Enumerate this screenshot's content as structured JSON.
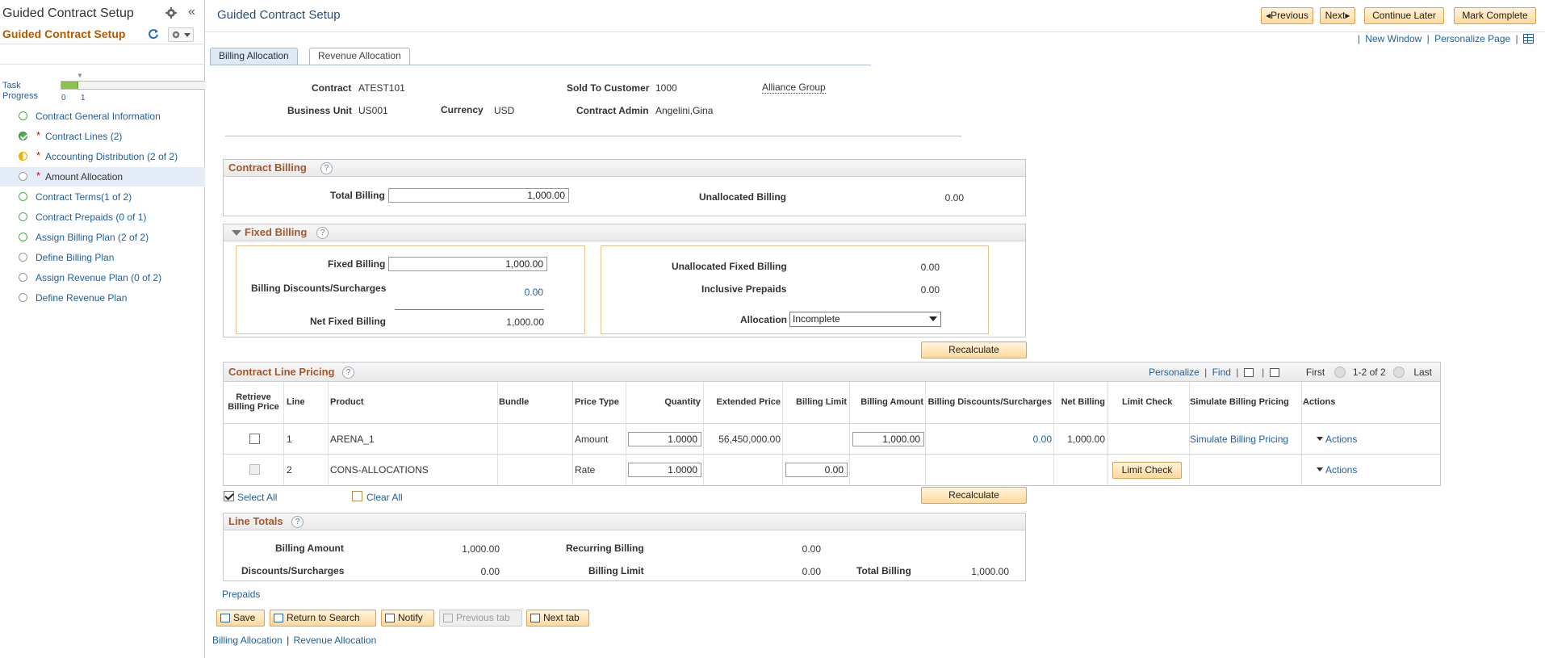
{
  "sidebar": {
    "title": "Guided Contract Setup",
    "subtitle": "Guided Contract Setup",
    "progress": {
      "label_line1": "Task",
      "label_line2": "Progress",
      "tick0": "0",
      "tick1": "1",
      "fraction": 0.12
    },
    "tasks": [
      {
        "label": "Contract General Information",
        "status": "complete-ring",
        "required": false,
        "active": false
      },
      {
        "label": "Contract Lines (2)",
        "status": "complete-check",
        "required": true,
        "active": false
      },
      {
        "label": "Accounting Distribution (2 of 2)",
        "status": "in-progress",
        "required": true,
        "active": false
      },
      {
        "label": "Amount Allocation",
        "status": "not-started",
        "required": true,
        "active": true
      },
      {
        "label": "Contract Terms(1 of 2)",
        "status": "complete-ring",
        "required": false,
        "active": false
      },
      {
        "label": "Contract Prepaids (0 of 1)",
        "status": "complete-ring",
        "required": false,
        "active": false
      },
      {
        "label": "Assign Billing Plan (2 of 2)",
        "status": "complete-ring",
        "required": false,
        "active": false
      },
      {
        "label": "Define Billing Plan",
        "status": "not-started",
        "required": false,
        "active": false
      },
      {
        "label": "Assign Revenue Plan (0 of 2)",
        "status": "not-started",
        "required": false,
        "active": false
      },
      {
        "label": "Define Revenue Plan",
        "status": "not-started",
        "required": false,
        "active": false
      }
    ],
    "required_marker": "*",
    "collapse_glyph": "«"
  },
  "header": {
    "title": "Guided Contract Setup",
    "buttons": {
      "previous": "Previous",
      "next": "Next",
      "continue_later": "Continue Later",
      "mark_complete": "Mark Complete"
    },
    "links": {
      "new_window": "New Window",
      "personalize_page": "Personalize Page",
      "sep": "|"
    }
  },
  "tabs": [
    {
      "label": "Billing Allocation",
      "active": true
    },
    {
      "label": "Revenue Allocation",
      "active": false
    }
  ],
  "contract": {
    "contract_label": "Contract",
    "contract_value": "ATEST101",
    "sold_to_label": "Sold To Customer",
    "sold_to_value": "1000",
    "customer_name": "Alliance Group",
    "bu_label": "Business Unit",
    "bu_value": "US001",
    "currency_label": "Currency",
    "currency_value": "USD",
    "admin_label": "Contract Admin",
    "admin_value": "Angelini,Gina"
  },
  "contract_billing": {
    "title": "Contract Billing",
    "total_billing_label": "Total Billing",
    "total_billing_value": "1,000.00",
    "unallocated_label": "Unallocated Billing",
    "unallocated_value": "0.00"
  },
  "fixed_billing": {
    "title": "Fixed Billing",
    "fixed_billing_label": "Fixed Billing",
    "fixed_billing_value": "1,000.00",
    "discounts_label": "Billing Discounts/Surcharges",
    "discounts_value": "0.00",
    "net_label": "Net Fixed Billing",
    "net_value": "1,000.00",
    "unalloc_fixed_label": "Unallocated Fixed Billing",
    "unalloc_fixed_value": "0.00",
    "inclusive_label": "Inclusive Prepaids",
    "inclusive_value": "0.00",
    "allocation_label": "Allocation",
    "allocation_value": "Incomplete"
  },
  "recalculate": "Recalculate",
  "pricing": {
    "title": "Contract Line Pricing",
    "toolbar": {
      "personalize": "Personalize",
      "find": "Find",
      "first": "First",
      "range": "1-2 of 2",
      "last": "Last",
      "sep": "|"
    },
    "columns": {
      "retrieve1": "Retrieve",
      "retrieve2": "Billing Price",
      "line": "Line",
      "product": "Product",
      "bundle": "Bundle",
      "price_type": "Price Type",
      "quantity": "Quantity",
      "extended_price": "Extended Price",
      "billing_limit": "Billing Limit",
      "billing_amount": "Billing Amount",
      "discounts": "Billing Discounts/Surcharges",
      "net_billing": "Net Billing",
      "limit_check": "Limit Check",
      "simulate": "Simulate Billing Pricing",
      "actions": "Actions"
    },
    "rows": [
      {
        "line": "1",
        "product": "ARENA_1",
        "price_type": "Amount",
        "quantity": "1.0000",
        "extended_price": "56,450,000.00",
        "billing_amount": "1,000.00",
        "discounts": "0.00",
        "net_billing": "1,000.00",
        "simulate": "Simulate Billing Pricing",
        "actions": "Actions"
      },
      {
        "line": "2",
        "product": "CONS-ALLOCATIONS",
        "price_type": "Rate",
        "quantity": "1.0000",
        "billing_limit": "0.00",
        "limit_check": "Limit Check",
        "actions": "Actions"
      }
    ],
    "select_all": "Select All",
    "clear_all": "Clear All"
  },
  "line_totals": {
    "title": "Line Totals",
    "billing_amount_label": "Billing Amount",
    "billing_amount_value": "1,000.00",
    "recurring_label": "Recurring Billing",
    "recurring_value": "0.00",
    "discounts_label": "Discounts/Surcharges",
    "discounts_value": "0.00",
    "billing_limit_label": "Billing Limit",
    "billing_limit_value": "0.00",
    "total_billing_label": "Total Billing",
    "total_billing_value": "1,000.00"
  },
  "footer": {
    "prepaids_link": "Prepaids",
    "buttons": {
      "save": "Save",
      "return_to_search": "Return to Search",
      "notify": "Notify",
      "previous_tab": "Previous tab",
      "next_tab": "Next tab"
    },
    "links": {
      "billing_allocation": "Billing Allocation",
      "sep": "|",
      "revenue_allocation": "Revenue Allocation"
    }
  }
}
